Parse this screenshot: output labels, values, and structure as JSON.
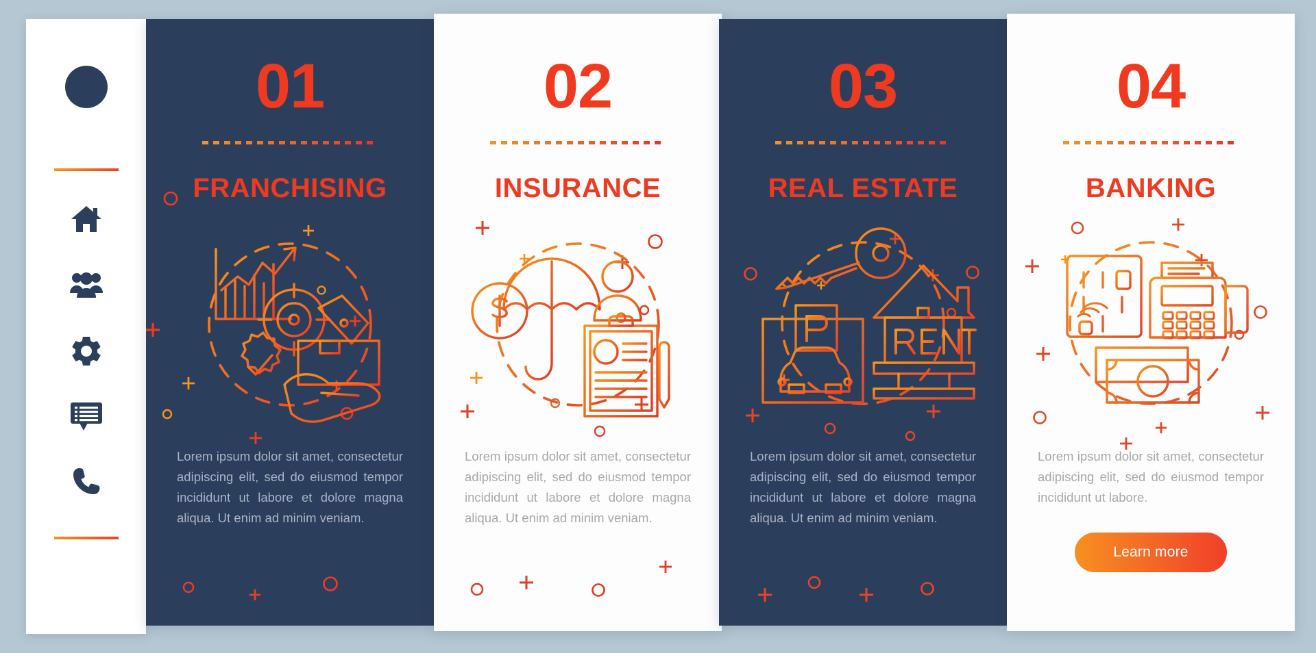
{
  "palette": {
    "background": "#b5c7d3",
    "card_dark": "#2b3f5c",
    "card_light": "#fdfdfd",
    "accent_red": "#f03a20",
    "accent_orange": "#f7941e",
    "body_text_dark_card": "#a9b3c2",
    "body_text_light_card": "#a8a8a8",
    "button_gradient_from": "#f79021",
    "button_gradient_to": "#f0402a"
  },
  "sidebar": {
    "avatar": "avatar-circle",
    "divider_top": "dashed-divider",
    "divider_bottom": "dashed-divider",
    "items": [
      {
        "icon": "home-icon",
        "label": "Home"
      },
      {
        "icon": "users-icon",
        "label": "Users"
      },
      {
        "icon": "gear-icon",
        "label": "Settings"
      },
      {
        "icon": "chat-list-icon",
        "label": "Messages"
      },
      {
        "icon": "phone-icon",
        "label": "Contact"
      }
    ]
  },
  "cards": [
    {
      "number": "01",
      "title": "FRANCHISING",
      "body": "Lorem ipsum dolor sit amet, consectetur adipiscing elit, sed do eiusmod tempor incididunt ut labore et dolore magna aliqua. Ut enim ad minim veniam.",
      "theme": "dark",
      "illustration": "franchising-illustration",
      "button": null
    },
    {
      "number": "02",
      "title": "INSURANCE",
      "body": "Lorem ipsum dolor sit amet, consectetur adipiscing elit, sed do eiusmod tempor incididunt ut labore et dolore magna aliqua. Ut enim ad minim veniam.",
      "theme": "light",
      "illustration": "insurance-illustration",
      "button": null
    },
    {
      "number": "03",
      "title": "REAL ESTATE",
      "body": "Lorem ipsum dolor sit amet, consectetur adipiscing elit, sed do eiusmod tempor incididunt ut labore et dolore magna aliqua. Ut enim ad minim veniam.",
      "theme": "dark",
      "illustration": "real-estate-illustration",
      "button": null
    },
    {
      "number": "04",
      "title": "BANKING",
      "body": "Lorem ipsum dolor sit amet, consectetur adipiscing elit, sed do eiusmod tempor incididunt ut labore.",
      "theme": "light",
      "illustration": "banking-illustration",
      "button": "Learn more"
    }
  ],
  "illustration_elements": {
    "franchising": [
      "bar-chart-with-arrow",
      "target-icon",
      "quality-badge-check",
      "price-tag",
      "box-in-hand"
    ],
    "insurance": [
      "umbrella",
      "dollar-coin",
      "person-avatar",
      "clipboard-document",
      "pen"
    ],
    "real_estate": [
      "key",
      "parking-garage-with-car",
      "house-with-rent-sign"
    ],
    "banking": [
      "credit-card-contactless",
      "pos-terminal",
      "banknotes"
    ]
  },
  "real_estate_labels": {
    "parking": "P",
    "rent": "RENT"
  },
  "insurance_labels": {
    "currency": "$"
  }
}
